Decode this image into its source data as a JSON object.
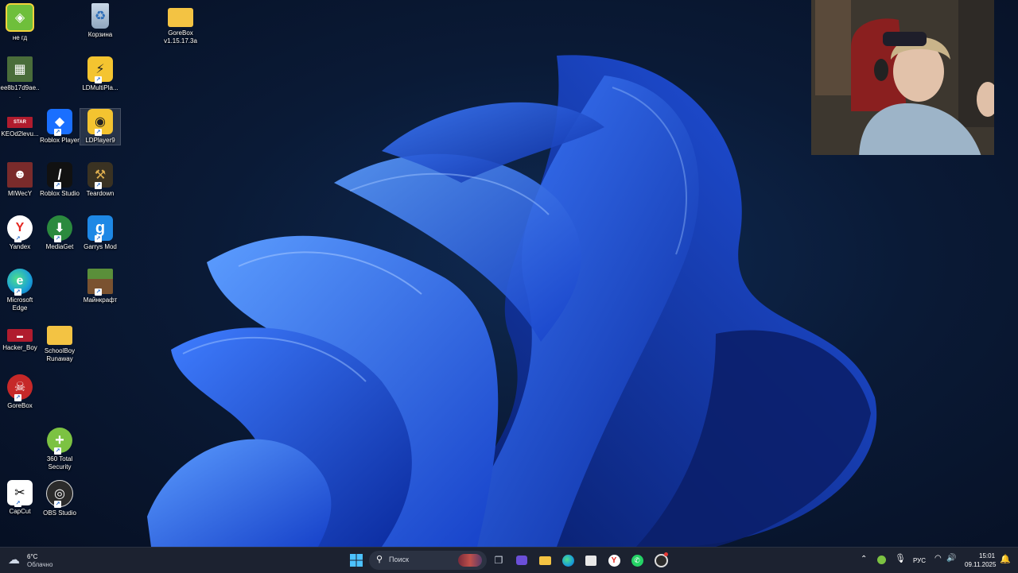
{
  "desktop": {
    "icons": [
      {
        "label": "не гд",
        "icon": "geometry-dash-icon",
        "color": "#6fbf3b"
      },
      {
        "label": "Корзина",
        "icon": "recycle-bin-icon",
        "color": "#9fb6cf"
      },
      {
        "label": "GoreBox v1.15.17.3a",
        "icon": "folder-icon",
        "color": "#f3c343"
      },
      {
        "label": "ee8b17d9ae...",
        "icon": "image-file-icon",
        "color": "#4a6d3a"
      },
      {
        "label": "LDMultiPla...",
        "icon": "ldmultiplayer-icon",
        "color": "#f4c430"
      },
      {
        "label": "KEOd2levu...",
        "icon": "image-file-icon",
        "color": "#b01c2e"
      },
      {
        "label": "Roblox Player",
        "icon": "roblox-icon",
        "color": "#1a6fff"
      },
      {
        "label": "LDPlayer9",
        "icon": "ldplayer-icon",
        "color": "#f4c430"
      },
      {
        "label": "MIWecY",
        "icon": "image-file-icon",
        "color": "#7a2b2b"
      },
      {
        "label": "Roblox Studio",
        "icon": "roblox-studio-icon",
        "color": "#111111"
      },
      {
        "label": "Teardown",
        "icon": "teardown-icon",
        "color": "#3a3222"
      },
      {
        "label": "Yandex",
        "icon": "yandex-browser-icon",
        "color": "#ffffff"
      },
      {
        "label": "MediaGet",
        "icon": "mediaget-icon",
        "color": "#2b8a3e"
      },
      {
        "label": "Garrys Mod",
        "icon": "garrys-mod-icon",
        "color": "#1e88e5"
      },
      {
        "label": "Microsoft Edge",
        "icon": "edge-icon",
        "color": "#1aa0d8"
      },
      {
        "label": "Майнкрафт",
        "icon": "minecraft-icon",
        "color": "#5a8f3a"
      },
      {
        "label": "Hacker_Boy",
        "icon": "game-icon",
        "color": "#b01c2e"
      },
      {
        "label": "SchoolBoy Runaway",
        "icon": "folder-icon",
        "color": "#f3c343"
      },
      {
        "label": "GoreBox",
        "icon": "gorebox-icon",
        "color": "#c62828"
      },
      {
        "label": "360 Total Security",
        "icon": "360-security-icon",
        "color": "#7cc242"
      },
      {
        "label": "CapCut",
        "icon": "capcut-icon",
        "color": "#ffffff"
      },
      {
        "label": "OBS Studio",
        "icon": "obs-icon",
        "color": "#2b2b2b"
      }
    ]
  },
  "taskbar": {
    "weather": {
      "temp": "6°C",
      "condition": "Облачно"
    },
    "search_placeholder": "Поиск",
    "language": "РУС",
    "time": "15:01",
    "date": "09.11.2025"
  },
  "colors": {
    "accent": "#1a63c7",
    "taskbar": "#1c2230"
  }
}
